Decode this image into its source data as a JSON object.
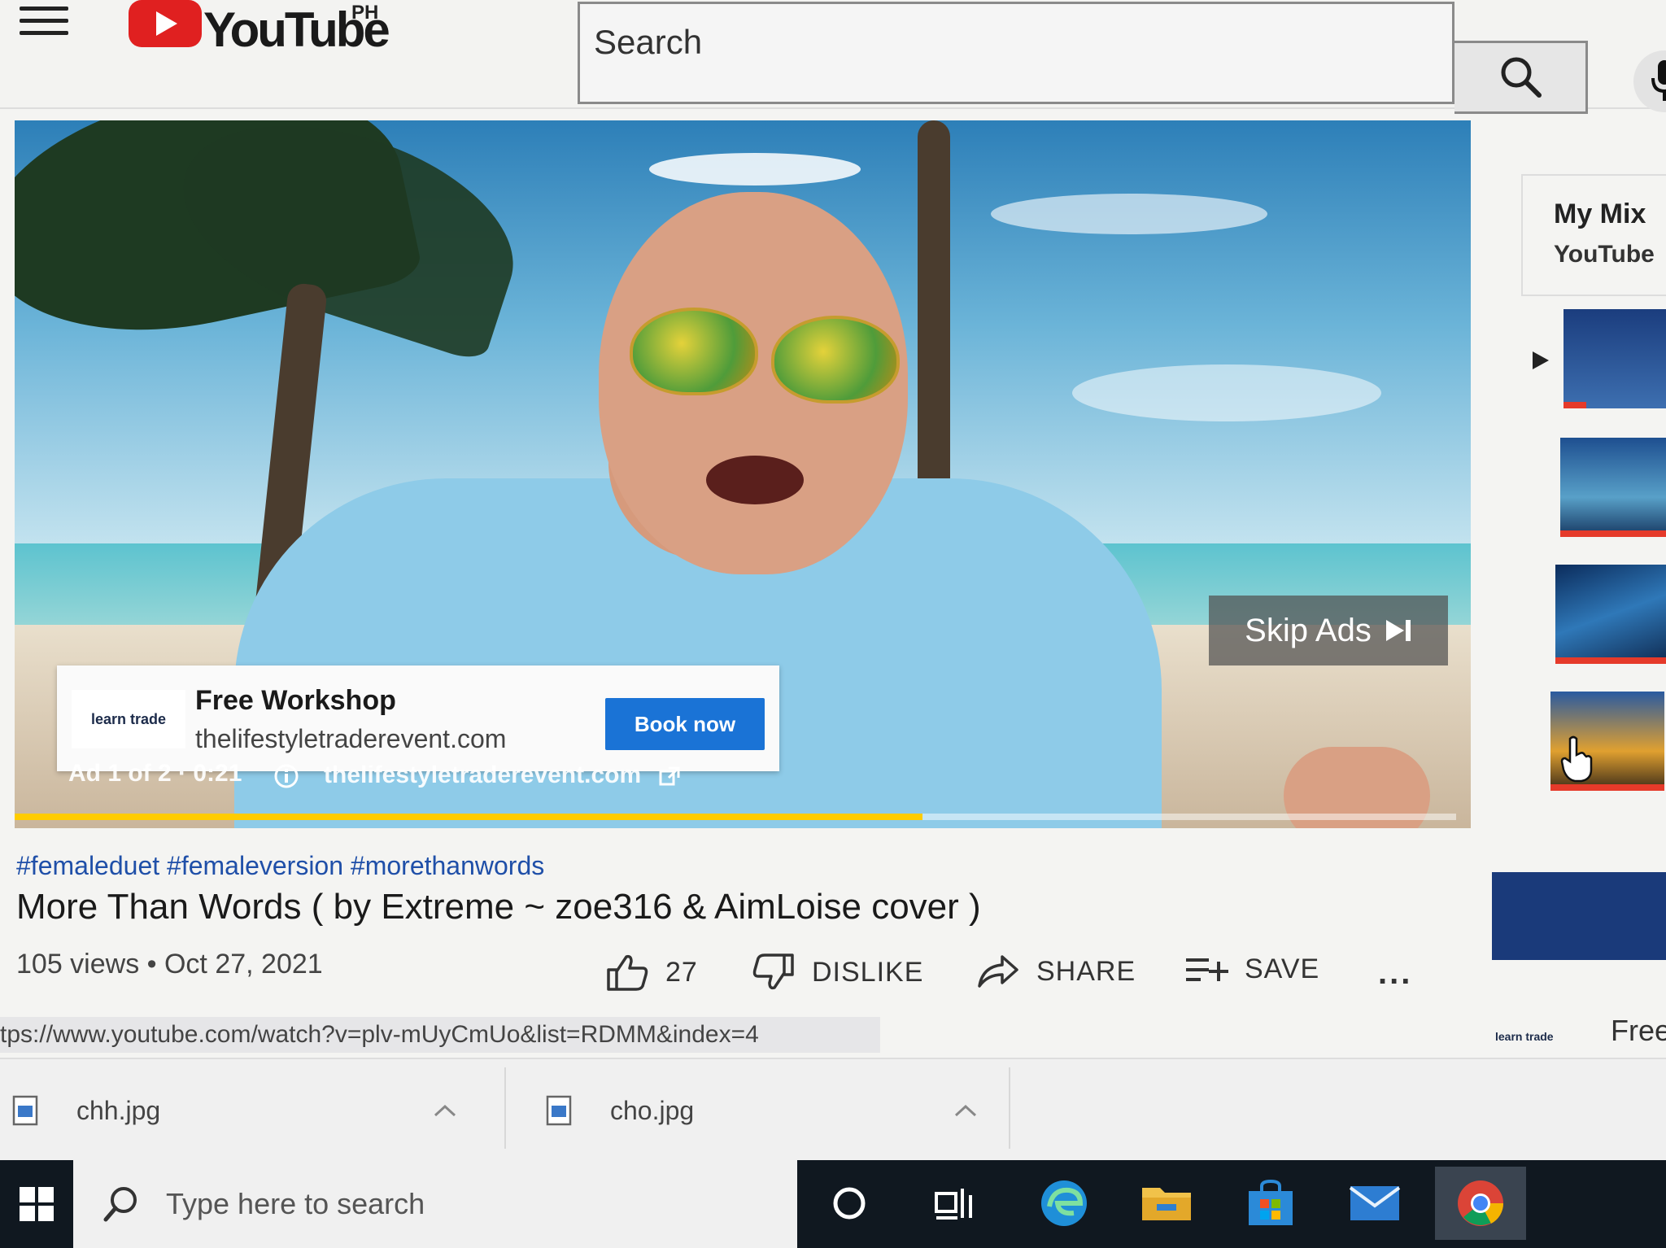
{
  "header": {
    "logo_text": "YouTube",
    "region": "PH",
    "search_placeholder": "Search"
  },
  "ad": {
    "card_title": "Free Workshop",
    "card_url": "thelifestyletraderevent.com",
    "cta_label": "Book now",
    "skip_label": "Skip Ads",
    "ad_counter": "Ad 1 of 2 · 0:21",
    "ad_link": "thelifestyletraderevent.com",
    "logo_left": "learn",
    "logo_right": "trade",
    "progress_fraction": 0.63
  },
  "sidebar": {
    "mix_title": "My Mix",
    "mix_subtitle": "YouTube"
  },
  "video": {
    "hashtags": "#femaleduet #femaleversion #morethanwords",
    "title": "More Than Words ( by Extreme ~ zoe316 & AimLoise cover )",
    "meta": "105 views • Oct 27, 2021",
    "likes": "27",
    "dislike_label": "DISLIKE",
    "share_label": "SHARE",
    "save_label": "SAVE",
    "more_label": "..."
  },
  "status_url": "tps://www.youtube.com/watch?v=plv-mUyCmUo&list=RDMM&index=4",
  "mini_ad": {
    "text": "Free",
    "logo_left": "learn",
    "logo_right": "trade"
  },
  "downloads": [
    {
      "name": "chh.jpg"
    },
    {
      "name": "cho.jpg"
    }
  ],
  "taskbar": {
    "search_placeholder": "Type here to search"
  }
}
